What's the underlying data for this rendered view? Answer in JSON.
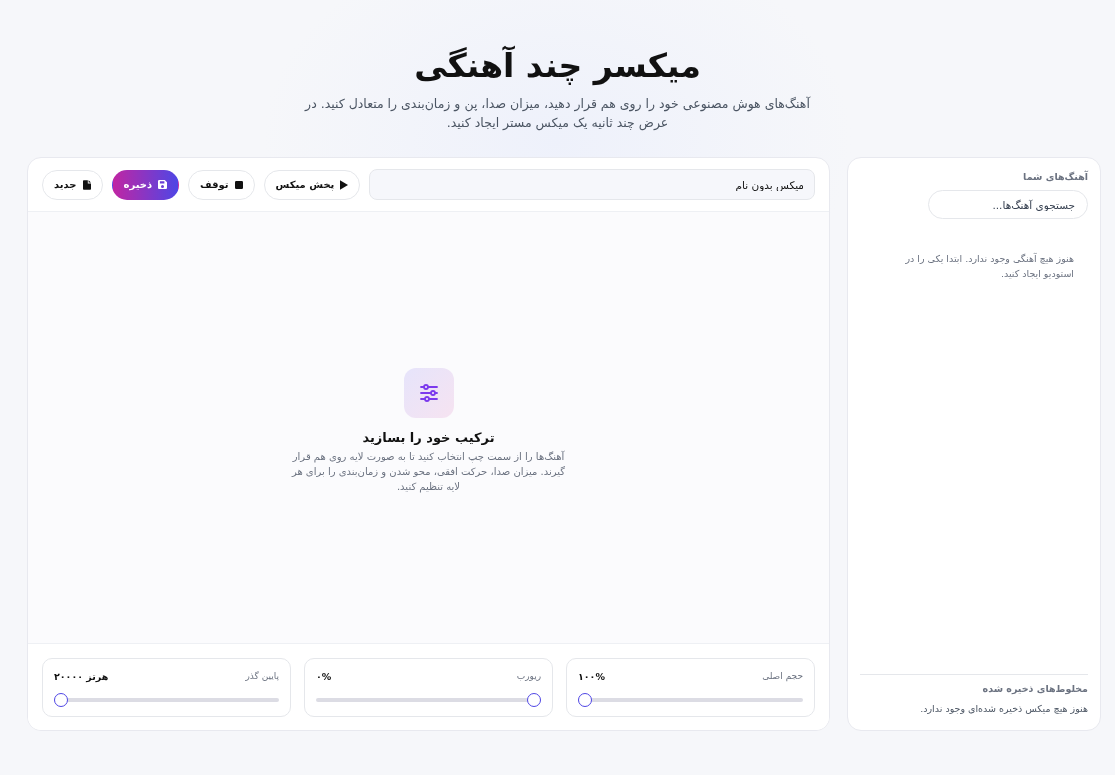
{
  "header": {
    "title": "میکسر چند آهنگی",
    "subtitle": "آهنگ‌های هوش مصنوعی خود را روی هم قرار دهید، میزان صدا، پن و زمان‌بندی را متعادل کنید. در عرض چند ثانیه یک میکس مستر ایجاد کنید."
  },
  "sidebar": {
    "title": "آهنگ‌های شما",
    "search": {
      "placeholder": "جستجوی آهنگ‌ها..."
    },
    "empty_message": "هنوز هیچ آهنگی وجود ندارد. ابتدا یکی را در استودیو ایجاد کنید.",
    "saved_mixes": {
      "title": "مخلوط‌های ذخیره شده",
      "empty_message": "هنوز هیچ میکس ذخیره شده‌ای وجود ندارد."
    }
  },
  "mixer": {
    "toolbar": {
      "mix_name": {
        "value": "میکس بدون نام"
      },
      "buttons": [
        {
          "label": "پخش میکس",
          "kind": "play"
        },
        {
          "label": "توقف",
          "kind": "stop"
        },
        {
          "label": "ذخیره",
          "kind": "save"
        },
        {
          "label": "جدید",
          "kind": "new"
        }
      ]
    },
    "empty_state": {
      "title": "ترکیب خود را بسازید",
      "text": "آهنگ‌ها را از سمت چپ انتخاب کنید تا به صورت لایه روی هم قرار گیرند. میزان صدا، حرکت افقی، محو شدن و زمان‌بندی را برای هر لایه تنظیم کنید."
    },
    "controls": [
      {
        "label": "حجم اصلی",
        "reading": "۱۰۰%",
        "level": 1
      },
      {
        "label": "ریورب",
        "reading": "۰%",
        "level": 0
      },
      {
        "label": "پایین گذر",
        "reading": "هرتز ۲۰۰۰۰",
        "level": 1
      }
    ]
  }
}
